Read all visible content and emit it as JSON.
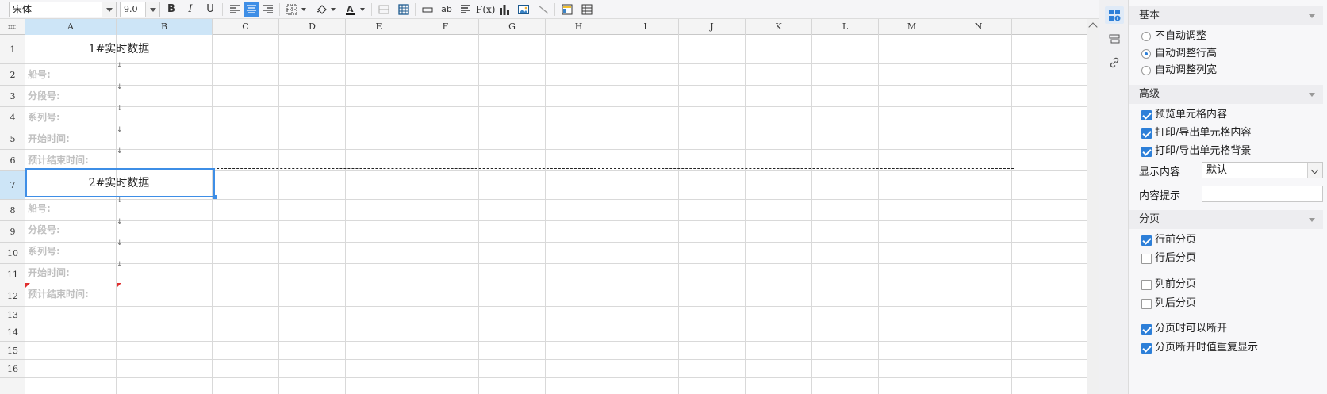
{
  "toolbar": {
    "font_name": "宋体",
    "font_size": "9.0",
    "bold_label": "B",
    "italic_label": "I",
    "underline_label": "U",
    "text_color": "#1a1a1a",
    "abc_label": "ab",
    "formula_label": "F(x)"
  },
  "columns": [
    "A",
    "B",
    "C",
    "D",
    "E",
    "F",
    "G",
    "H",
    "I",
    "J",
    "K",
    "L",
    "M",
    "N"
  ],
  "rows": [
    "1",
    "2",
    "3",
    "4",
    "5",
    "6",
    "7",
    "8",
    "9",
    "10",
    "11",
    "12",
    "13",
    "14",
    "15",
    "16"
  ],
  "sheet": {
    "title1": "1#实时数据",
    "title2": "2#实时数据",
    "group1": [
      "船号:",
      "分段号:",
      "系列号:",
      "开始时间:",
      "预计结束时间:"
    ],
    "group2": [
      "船号:",
      "分段号:",
      "系列号:",
      "开始时间:",
      "预计结束时间:"
    ],
    "expand_mark": "↓"
  },
  "panel": {
    "basic": {
      "title": "基本",
      "options": [
        {
          "label": "不自动调整",
          "selected": false
        },
        {
          "label": "自动调整行高",
          "selected": true
        },
        {
          "label": "自动调整列宽",
          "selected": false
        }
      ]
    },
    "advanced": {
      "title": "高级",
      "checks": [
        {
          "label": "预览单元格内容",
          "checked": true
        },
        {
          "label": "打印/导出单元格内容",
          "checked": true
        },
        {
          "label": "打印/导出单元格背景",
          "checked": true
        }
      ],
      "display_content_label": "显示内容",
      "display_content_value": "默认",
      "content_tip_label": "内容提示",
      "content_tip_value": ""
    },
    "paging": {
      "title": "分页",
      "checks": [
        {
          "label": "行前分页",
          "checked": true
        },
        {
          "label": "行后分页",
          "checked": false
        },
        {
          "label": "列前分页",
          "checked": false
        },
        {
          "label": "列后分页",
          "checked": false
        },
        {
          "label": "分页时可以断开",
          "checked": true
        },
        {
          "label": "分页断开时值重复显示",
          "checked": true
        }
      ]
    }
  },
  "colors": {
    "accent": "#3e8ee6",
    "header_selected": "#cde5f7",
    "label_gray": "#c0c0c0",
    "red_marker": "#e03030"
  }
}
